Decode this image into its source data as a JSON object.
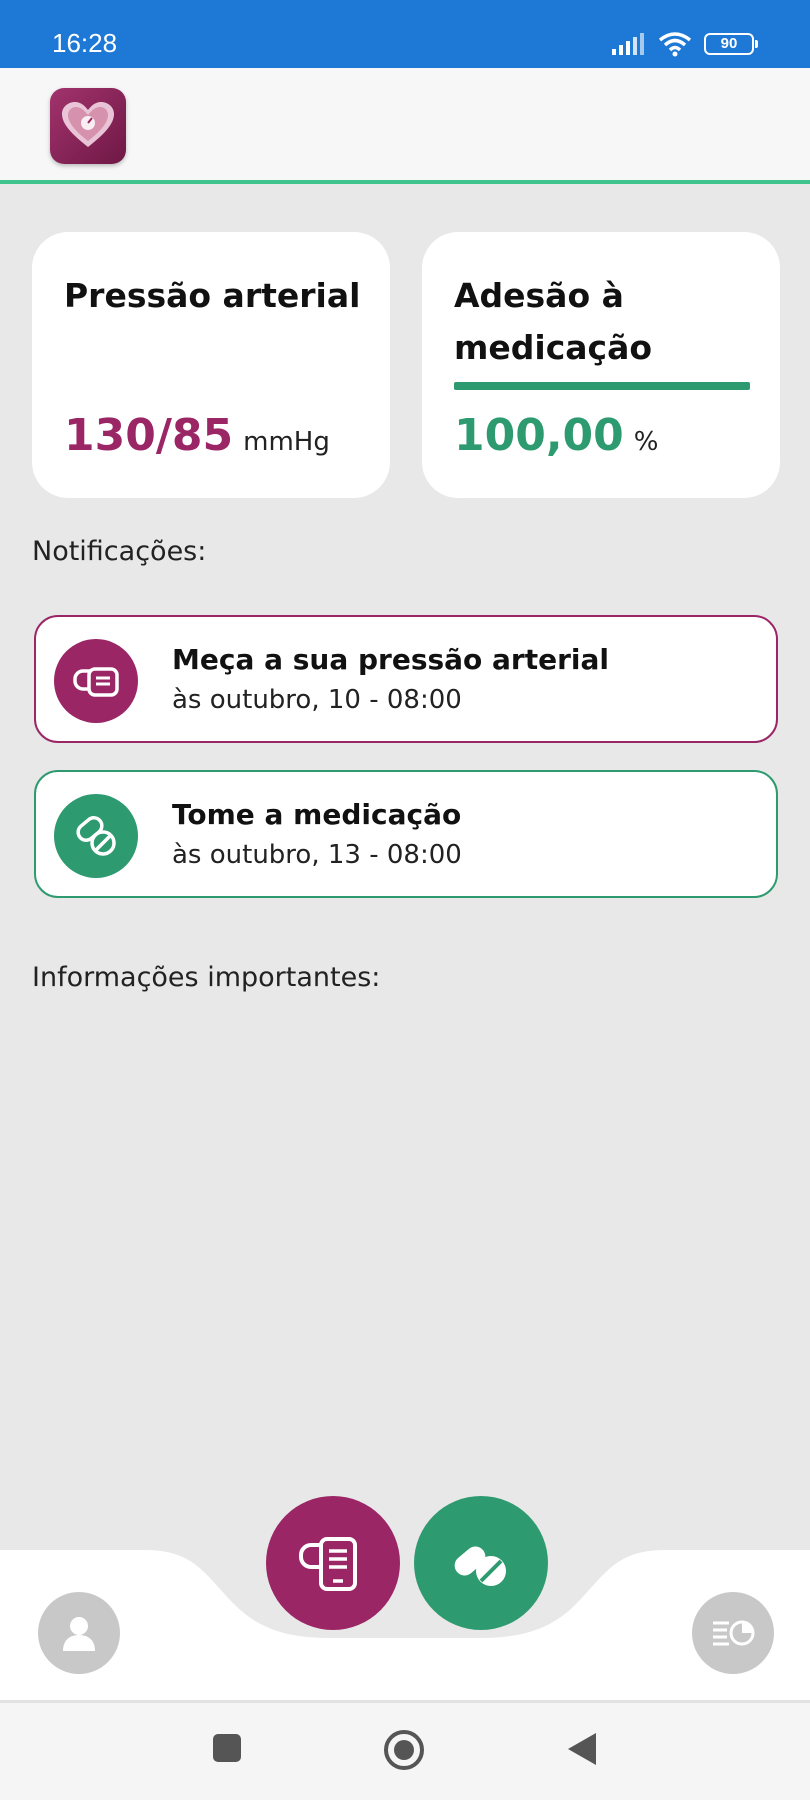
{
  "status_bar": {
    "time": "16:28",
    "battery": "90",
    "icons": [
      "signal-icon",
      "wifi-icon",
      "battery-icon"
    ],
    "color": "#1e78d6"
  },
  "app": {
    "logo": "heart-logo-icon",
    "accent_primary": "#9b2665",
    "accent_secondary": "#2e9a70"
  },
  "cards": {
    "blood_pressure": {
      "title": "Pressão arterial",
      "value": "130/85",
      "unit": "mmHg"
    },
    "adherence": {
      "title": "Adesão à medicação",
      "value": "100,00",
      "unit": "%",
      "progress_fraction": 1.0
    }
  },
  "sections": {
    "notifications_label": "Notificações:",
    "important_info_label": "Informações importantes:"
  },
  "notifications": [
    {
      "icon": "blood-pressure-monitor-icon",
      "title": "Meça a sua pressão arterial",
      "subtitle": "às outubro, 10 - 08:00"
    },
    {
      "icon": "pills-icon",
      "title": "Tome a medicação",
      "subtitle": "às outubro, 13 - 08:00"
    }
  ],
  "bottom_nav": {
    "items": [
      "profile-icon",
      "blood-pressure-monitor-icon",
      "pills-icon",
      "stats-icon"
    ]
  },
  "system_nav": {
    "items": [
      "recent-apps-icon",
      "home-icon",
      "back-icon"
    ]
  }
}
